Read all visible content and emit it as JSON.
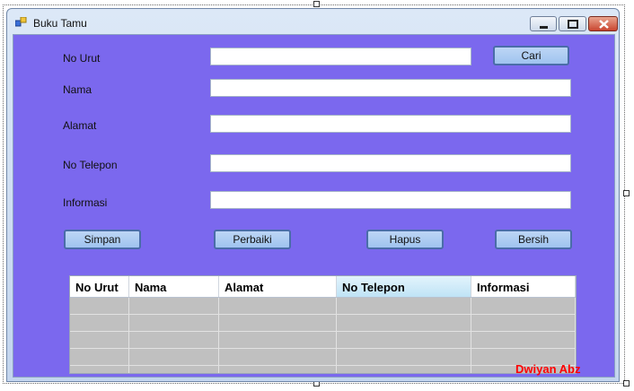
{
  "window": {
    "title": "Buku Tamu"
  },
  "form": {
    "no_urut": {
      "label": "No Urut",
      "value": ""
    },
    "nama": {
      "label": "Nama",
      "value": ""
    },
    "alamat": {
      "label": "Alamat",
      "value": ""
    },
    "no_telepon": {
      "label": "No Telepon",
      "value": ""
    },
    "informasi": {
      "label": "Informasi",
      "value": ""
    },
    "cari_label": "Cari"
  },
  "buttons": {
    "simpan": "Simpan",
    "perbaiki": "Perbaiki",
    "hapus": "Hapus",
    "bersih": "Bersih"
  },
  "grid": {
    "columns": [
      "No Urut",
      "Nama",
      "Alamat",
      "No Telepon",
      "Informasi"
    ],
    "selected_column": "No Telepon"
  },
  "watermark": "Dwiyan Abz",
  "colors": {
    "form_background": "#7b68ee",
    "watermark": "#ff0000",
    "grid_empty": "#c0c0c0"
  }
}
